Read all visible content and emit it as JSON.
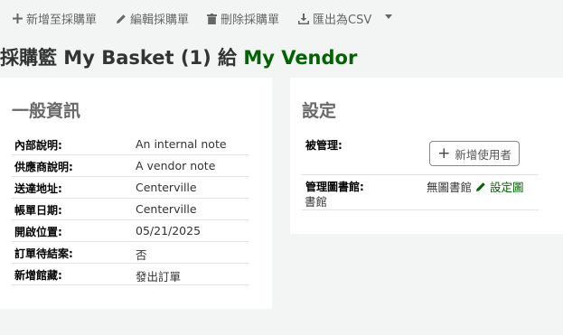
{
  "toolbar": {
    "add_label": "新增至採購單",
    "edit_label": "編輯採購單",
    "delete_label": "刪除採購單",
    "export_label": "匯出為CSV"
  },
  "title": {
    "prefix": "採購籃 My Basket (1) 給",
    "vendor": "My Vendor"
  },
  "general": {
    "heading": "一般資訊",
    "rows": [
      {
        "label": "內部說明:",
        "value": "An internal note"
      },
      {
        "label": "供應商說明:",
        "value": "A vendor note"
      },
      {
        "label": "送達地址:",
        "value": "Centerville"
      },
      {
        "label": "帳單日期:",
        "value": "Centerville"
      },
      {
        "label": "開啟位置:",
        "value": "05/21/2025"
      },
      {
        "label": "訂單待結案:",
        "value": "否"
      },
      {
        "label": "新增館藏:",
        "value": "發出訂單"
      }
    ]
  },
  "settings": {
    "heading": "設定",
    "managed_label": "被管理:",
    "add_user_label": "新增使用者",
    "library_label": "管理圖書館:",
    "library_value": "無圖書館",
    "set_library_part1": "設定圖",
    "set_library_part2": "書館"
  }
}
